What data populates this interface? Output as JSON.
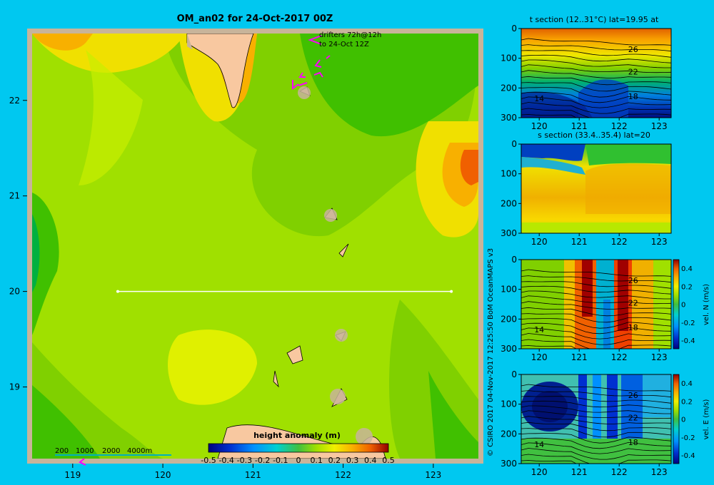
{
  "colors": {
    "background": "#00c8f0",
    "frame": "#c8b49a",
    "land": "#f8c8a0",
    "drifter": "#ff00ff",
    "section_line": "#ffffff"
  },
  "chart_data": [
    {
      "type": "heatmap",
      "title": "OM_an02 for 24-Oct-2017 00Z",
      "x_ticks": [
        "119",
        "120",
        "121",
        "122",
        "123"
      ],
      "y_ticks": [
        "22",
        "21",
        "20",
        "19"
      ],
      "xlim": [
        118.55,
        123.5
      ],
      "ylim": [
        18.25,
        22.7
      ],
      "drifter_note": [
        "drifters 72h@12h",
        "to 24-Oct 12Z"
      ],
      "section_line": {
        "lat": 20,
        "lon_start": 119.5,
        "lon_end": 123.2
      },
      "islands": [
        {
          "lon": 121.8,
          "lat": 20.8
        },
        {
          "lon": 121.9,
          "lat": 20.4
        },
        {
          "lon": 121.95,
          "lat": 19.55
        },
        {
          "lon": 121.55,
          "lat": 19.35
        },
        {
          "lon": 121.2,
          "lat": 19.15
        },
        {
          "lon": 121.95,
          "lat": 18.95
        },
        {
          "lon": 121.4,
          "lat": 18.9
        }
      ],
      "depth_scale": {
        "labels": [
          "200",
          "1000",
          "2000",
          "4000m"
        ]
      },
      "colorbar": {
        "label": "height anomaly  (m)",
        "ticks": [
          "-0.5",
          "-0.4",
          "-0.3",
          "-0.2",
          "-0.1",
          "0",
          "0.1",
          "0.2",
          "0.3",
          "0.4",
          "0.5"
        ],
        "range": [
          -0.5,
          0.5
        ]
      }
    },
    {
      "type": "heatmap",
      "title": "t section (12..31°C) lat=19.95 at",
      "x_ticks": [
        "120",
        "121",
        "122",
        "123"
      ],
      "y_ticks": [
        "0",
        "100",
        "200",
        "300"
      ],
      "xlim": [
        119.55,
        123.3
      ],
      "ylim": [
        300,
        0
      ],
      "contour_labels": [
        {
          "text": "26",
          "lon": 122.35,
          "depth": 70
        },
        {
          "text": "22",
          "lon": 122.35,
          "depth": 145
        },
        {
          "text": "18",
          "lon": 122.35,
          "depth": 228
        },
        {
          "text": "14",
          "lon": 120.0,
          "depth": 235
        }
      ]
    },
    {
      "type": "heatmap",
      "title": "s section (33.4..35.4) lat=20",
      "x_ticks": [
        "120",
        "121",
        "122",
        "123"
      ],
      "y_ticks": [
        "0",
        "100",
        "200",
        "300"
      ],
      "xlim": [
        119.55,
        123.3
      ],
      "ylim": [
        300,
        0
      ]
    },
    {
      "type": "heatmap",
      "x_ticks": [
        "120",
        "121",
        "122",
        "123"
      ],
      "y_ticks": [
        "0",
        "100",
        "200",
        "300"
      ],
      "xlim": [
        119.55,
        123.3
      ],
      "ylim": [
        300,
        0
      ],
      "contour_labels": [
        {
          "text": "26",
          "lon": 122.35,
          "depth": 70
        },
        {
          "text": "22",
          "lon": 122.35,
          "depth": 145
        },
        {
          "text": "18",
          "lon": 122.35,
          "depth": 228
        },
        {
          "text": "14",
          "lon": 120.0,
          "depth": 235
        }
      ],
      "colorbar": {
        "label": "vel. N  (m/s)",
        "ticks": [
          "0.4",
          "0.2",
          "0",
          "-0.2",
          "-0.4"
        ],
        "range": [
          -0.4,
          0.4
        ]
      }
    },
    {
      "type": "heatmap",
      "x_ticks": [
        "120",
        "121",
        "122",
        "123"
      ],
      "y_ticks": [
        "0",
        "100",
        "200",
        "300"
      ],
      "xlim": [
        119.55,
        123.3
      ],
      "ylim": [
        300,
        0
      ],
      "contour_labels": [
        {
          "text": "26",
          "lon": 122.35,
          "depth": 70
        },
        {
          "text": "22",
          "lon": 122.35,
          "depth": 145
        },
        {
          "text": "18",
          "lon": 122.35,
          "depth": 228
        },
        {
          "text": "14",
          "lon": 120.0,
          "depth": 235
        }
      ],
      "colorbar": {
        "label": "vel. E  (m/s)",
        "ticks": [
          "0.4",
          "0.2",
          "0",
          "-0.2",
          "-0.4"
        ],
        "range": [
          -0.4,
          0.4
        ]
      }
    }
  ],
  "credit": "© CSIRO 2017   04-Nov-2017 12:25:50 BoM OceanMAPS v3"
}
